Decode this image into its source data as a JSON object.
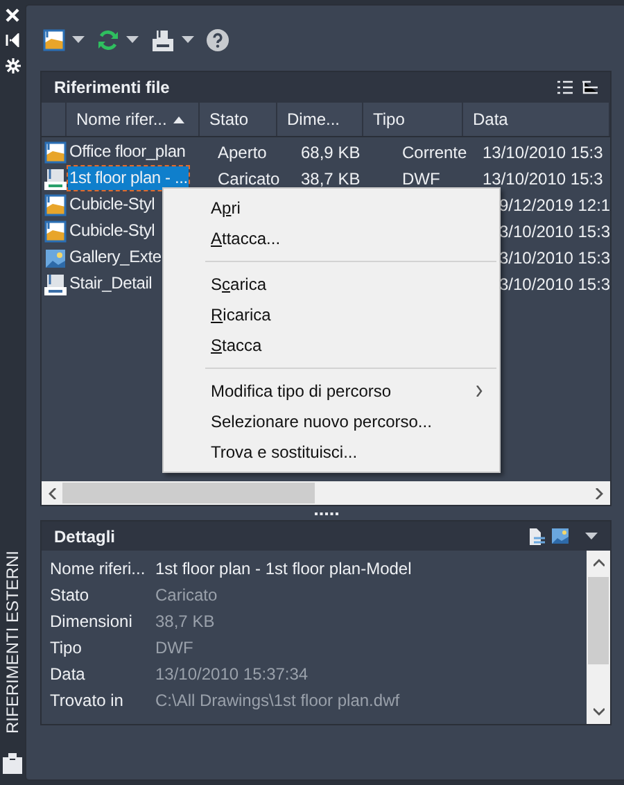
{
  "side_strip": {
    "title": "RIFERIMENTI ESTERNI"
  },
  "file_refs": {
    "title": "Riferimenti file",
    "columns": [
      {
        "label": "Nome rifer...",
        "sorted": true
      },
      {
        "label": "Stato",
        "sorted": false
      },
      {
        "label": "Dime...",
        "sorted": false
      },
      {
        "label": "Tipo",
        "sorted": false
      },
      {
        "label": "Data",
        "sorted": false
      }
    ],
    "rows": [
      {
        "kind": "dwg",
        "name": "Office floor_plan",
        "status": "Aperto",
        "size": "68,9 KB",
        "type": "Corrente",
        "date": "13/10/2010 15:3",
        "selected": false,
        "covered": false
      },
      {
        "kind": "dwf",
        "name": "1st floor plan - ...",
        "status": "Caricato",
        "size": "38,7 KB",
        "type": "DWF",
        "date": "13/10/2010 15:3",
        "selected": true,
        "covered": false
      },
      {
        "kind": "dwg",
        "name": "Cubicle-Styl",
        "date": "9/12/2019 12:1",
        "selected": false,
        "covered": true
      },
      {
        "kind": "dwg",
        "name": "Cubicle-Styl",
        "date": "3/10/2010 15:3",
        "selected": false,
        "covered": true
      },
      {
        "kind": "image",
        "name": "Gallery_Exte",
        "date": "3/10/2010 15:3",
        "selected": false,
        "covered": true
      },
      {
        "kind": "dgn",
        "name": "Stair_Detail",
        "date": "3/10/2010 15:3",
        "selected": false,
        "covered": true
      }
    ]
  },
  "context_menu": [
    {
      "kind": "item",
      "label": {
        "before": "A",
        "key": "p",
        "after": "ri"
      }
    },
    {
      "kind": "item",
      "label": {
        "key": "A",
        "after": "ttacca..."
      }
    },
    {
      "kind": "separator"
    },
    {
      "kind": "item",
      "label": {
        "before": "S",
        "key": "c",
        "after": "arica"
      }
    },
    {
      "kind": "item",
      "label": {
        "key": "R",
        "after": "icarica"
      }
    },
    {
      "kind": "item",
      "label": {
        "key": "S",
        "after": "tacca"
      }
    },
    {
      "kind": "separator"
    },
    {
      "kind": "submenu",
      "label": "Modifica tipo di percorso"
    },
    {
      "kind": "plain",
      "label": "Selezionare nuovo percorso..."
    },
    {
      "kind": "plain",
      "label": "Trova e sostituisci..."
    }
  ],
  "details": {
    "title": "Dettagli",
    "rows": [
      {
        "label": "Nome riferi...",
        "value": "1st floor plan - 1st floor plan-Model",
        "editable": true
      },
      {
        "label": "Stato",
        "value": "Caricato",
        "editable": false
      },
      {
        "label": "Dimensioni",
        "value": "38,7 KB",
        "editable": false
      },
      {
        "label": "Tipo",
        "value": "DWF",
        "editable": false
      },
      {
        "label": "Data",
        "value": "13/10/2010 15:37:34",
        "editable": false
      },
      {
        "label": "Trovato in",
        "value": "C:\\All Drawings\\1st floor plan.dwf",
        "editable": false
      }
    ]
  }
}
